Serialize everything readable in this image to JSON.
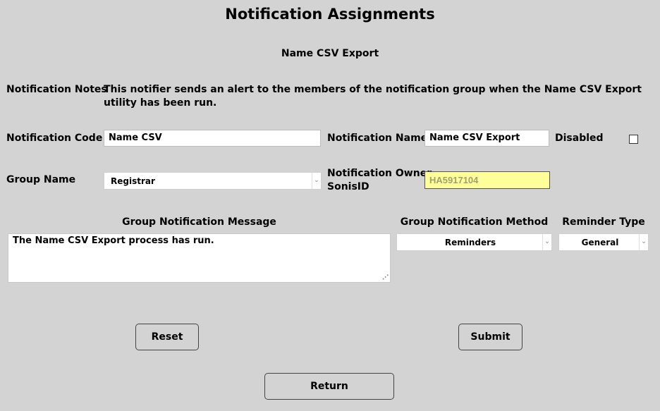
{
  "page": {
    "title": "Notification Assignments",
    "subtitle": "Name CSV Export"
  },
  "notes": {
    "label": "Notification Notes",
    "text": "This notifier sends an alert to the members of the notification group when the Name CSV Export utility has been run."
  },
  "code": {
    "label": "Notification Code",
    "value": "Name CSV"
  },
  "name": {
    "label": "Notification Name",
    "value": "Name CSV Export"
  },
  "disabled": {
    "label": "Disabled",
    "checked": false
  },
  "group": {
    "label": "Group Name",
    "value": "Registrar"
  },
  "owner": {
    "label_line1": "Notification Owner",
    "label_line2": "SonisID",
    "value": "HA5917104"
  },
  "message": {
    "label": "Group Notification Message",
    "value": "The Name CSV Export process has run."
  },
  "method": {
    "label": "Group Notification Method",
    "value": "Reminders"
  },
  "reminder": {
    "label": "Reminder Type",
    "value": "General"
  },
  "buttons": {
    "reset": "Reset",
    "submit": "Submit",
    "return": "Return"
  },
  "colors": {
    "background": "#d3d3d3",
    "owner_field": "#ffff99"
  },
  "icons": {
    "dropdown": "chevron-down-icon",
    "resize": "resize-grip-icon"
  }
}
